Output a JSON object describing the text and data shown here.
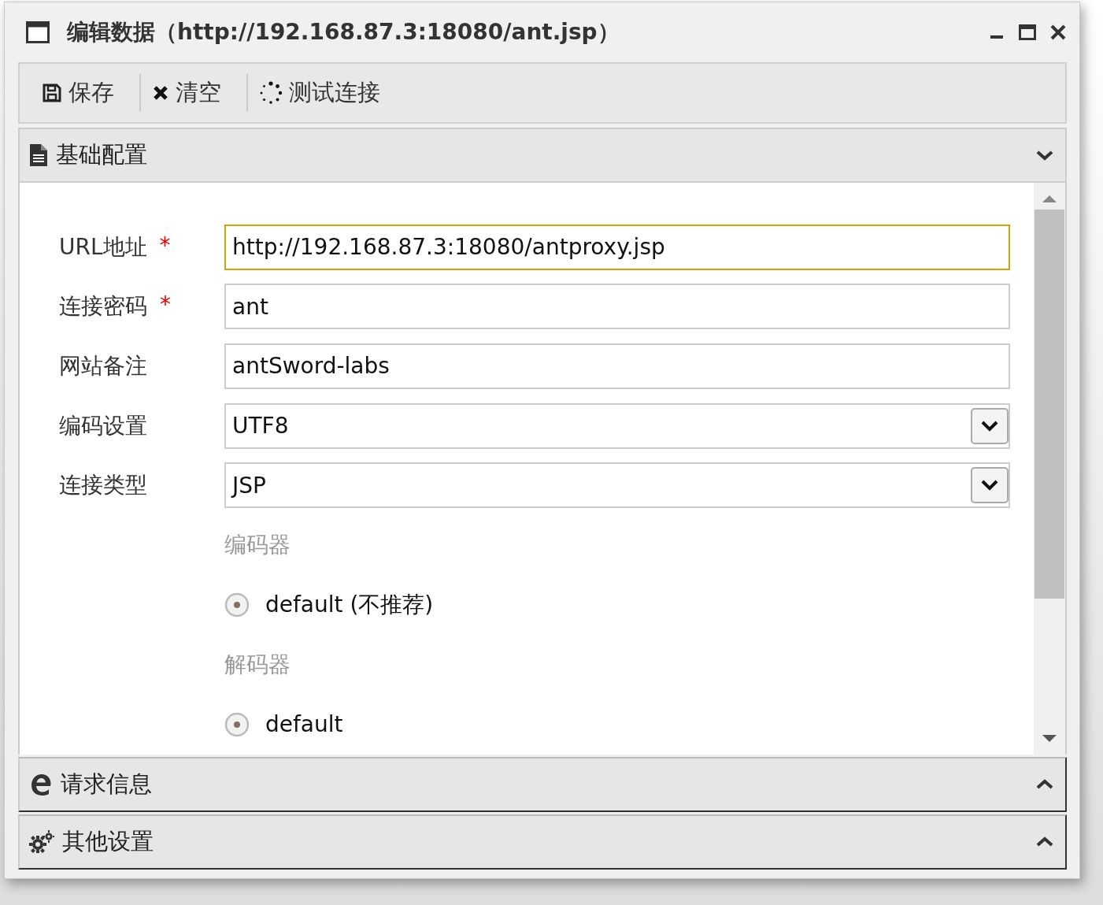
{
  "window": {
    "title": "编辑数据（http://192.168.87.3:18080/ant.jsp）"
  },
  "toolbar": [
    {
      "label": "保存"
    },
    {
      "label": "清空"
    },
    {
      "label": "测试连接"
    }
  ],
  "sections": [
    {
      "title": "基础配置",
      "expanded": true,
      "fields": [
        {
          "kind": "text",
          "label": "URL地址",
          "required_mark": "*",
          "value": "http://192.168.87.3:18080/antproxy.jsp",
          "focused": true
        },
        {
          "kind": "text",
          "label": "连接密码",
          "required_mark": "*",
          "value": "ant",
          "focused": false
        },
        {
          "kind": "text",
          "label": "网站备注",
          "value": "antSword-labs",
          "focused": false
        },
        {
          "kind": "select",
          "label": "编码设置",
          "value": "UTF8",
          "focused": false
        },
        {
          "kind": "select",
          "label": "连接类型",
          "value": "JSP",
          "focused": false
        }
      ],
      "groups": [
        {
          "label": "编码器",
          "options": [
            {
              "label": "default (不推荐)",
              "selected": true
            }
          ]
        },
        {
          "label": "解码器",
          "options": [
            {
              "label": "default",
              "selected": true
            }
          ]
        }
      ]
    },
    {
      "title": "请求信息",
      "expanded": false
    },
    {
      "title": "其他设置",
      "expanded": false
    }
  ]
}
